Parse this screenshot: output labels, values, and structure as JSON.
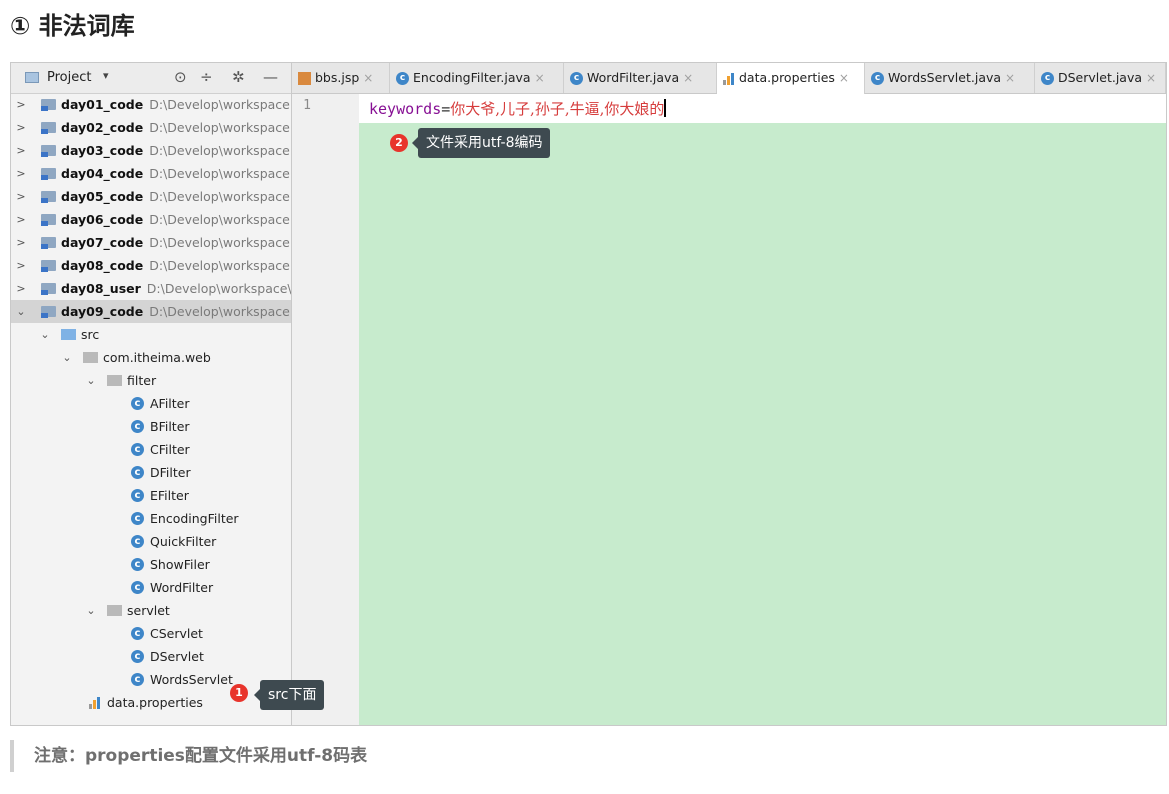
{
  "heading": "① 非法词库",
  "project_panel": {
    "title": "Project",
    "toolbar_icons": [
      "target-icon",
      "collapse-icon",
      "gear-icon",
      "minimize-icon"
    ]
  },
  "tree": {
    "modules": [
      {
        "name": "day01_code",
        "path": "D:\\Develop\\workspace"
      },
      {
        "name": "day02_code",
        "path": "D:\\Develop\\workspace"
      },
      {
        "name": "day03_code",
        "path": "D:\\Develop\\workspace"
      },
      {
        "name": "day04_code",
        "path": "D:\\Develop\\workspace"
      },
      {
        "name": "day05_code",
        "path": "D:\\Develop\\workspace"
      },
      {
        "name": "day06_code",
        "path": "D:\\Develop\\workspace"
      },
      {
        "name": "day07_code",
        "path": "D:\\Develop\\workspace"
      },
      {
        "name": "day08_code",
        "path": "D:\\Develop\\workspace"
      },
      {
        "name": "day08_user",
        "path": "D:\\Develop\\workspace\\"
      },
      {
        "name": "day09_code",
        "path": "D:\\Develop\\workspace"
      }
    ],
    "src": "src",
    "package": "com.itheima.web",
    "filter_folder": "filter",
    "filter_classes": [
      "AFilter",
      "BFilter",
      "CFilter",
      "DFilter",
      "EFilter",
      "EncodingFilter",
      "QuickFilter",
      "ShowFiler",
      "WordFilter"
    ],
    "servlet_folder": "servlet",
    "servlet_classes": [
      "CServlet",
      "DServlet",
      "WordsServlet"
    ],
    "properties_file": "data.properties"
  },
  "tabs": [
    {
      "label": "bbs.jsp",
      "icon": "jsp-icon"
    },
    {
      "label": "EncodingFilter.java",
      "icon": "class-icon"
    },
    {
      "label": "WordFilter.java",
      "icon": "class-icon"
    },
    {
      "label": "data.properties",
      "icon": "properties-icon",
      "active": true
    },
    {
      "label": "WordsServlet.java",
      "icon": "class-icon"
    },
    {
      "label": "DServlet.java",
      "icon": "class-icon"
    }
  ],
  "editor": {
    "line_number": "1",
    "key": "keywords",
    "eq": "=",
    "value": "你大爷,儿子,孙子,牛逼,你大娘的"
  },
  "callouts": {
    "one": {
      "badge": "1",
      "text": "src下面"
    },
    "two": {
      "badge": "2",
      "text": "文件采用utf-8编码"
    }
  },
  "note": "注意：properties配置文件采用utf-8码表",
  "colors": {
    "highlight": "#c7ebcd",
    "badge": "#e8342c",
    "tooltip": "#3e4a50",
    "property_key": "#871094",
    "property_value": "#d63c3c"
  }
}
